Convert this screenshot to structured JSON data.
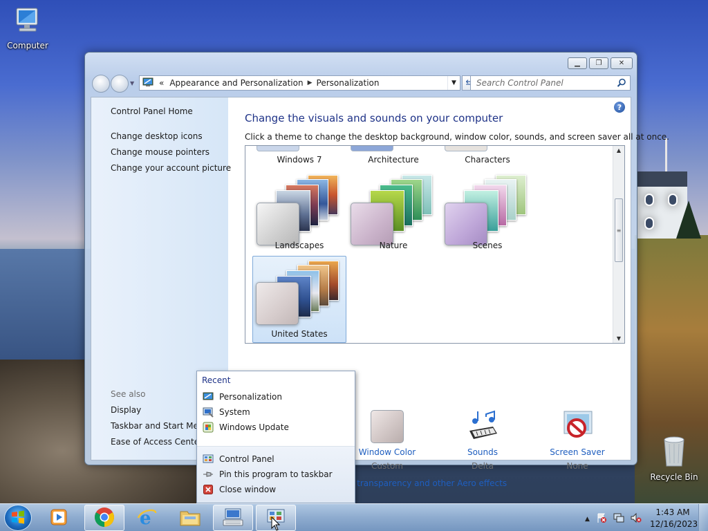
{
  "desktop": {
    "computer_label": "Computer",
    "recycle_label": "Recycle Bin"
  },
  "window": {
    "breadcrumb": {
      "chevrons": "«",
      "segments": [
        "Appearance and Personalization",
        "Personalization"
      ]
    },
    "search_placeholder": "Search Control Panel",
    "left_pane": {
      "home": "Control Panel Home",
      "links": [
        "Change desktop icons",
        "Change mouse pointers",
        "Change your account picture"
      ],
      "see_also_label": "See also",
      "see_also": [
        "Display",
        "Taskbar and Start Menu",
        "Ease of Access Center"
      ]
    },
    "heading": "Change the visuals and sounds on your computer",
    "subheading": "Click a theme to change the desktop background, window color, sounds, and screen saver all at once.",
    "themes": [
      {
        "label": "Windows 7"
      },
      {
        "label": "Architecture"
      },
      {
        "label": "Characters"
      },
      {
        "label": "Landscapes"
      },
      {
        "label": "Nature"
      },
      {
        "label": "Scenes"
      },
      {
        "label": "United States",
        "selected": true
      }
    ],
    "bottom": [
      {
        "label": "Window Color",
        "sub": "Custom"
      },
      {
        "label": "Sounds",
        "sub": "Delta"
      },
      {
        "label": "Screen Saver",
        "sub": "None"
      }
    ],
    "aero_link": "th transparency and other Aero effects"
  },
  "jump_list": {
    "header": "Recent",
    "recent": [
      "Personalization",
      "System",
      "Windows Update"
    ],
    "tasks": [
      "Control Panel",
      "Pin this program to taskbar",
      "Close window"
    ]
  },
  "taskbar": {
    "time": "1:43 AM",
    "date": "12/16/2023"
  },
  "colors": {
    "link": "#1e5ebf",
    "heading": "#1e3287"
  }
}
